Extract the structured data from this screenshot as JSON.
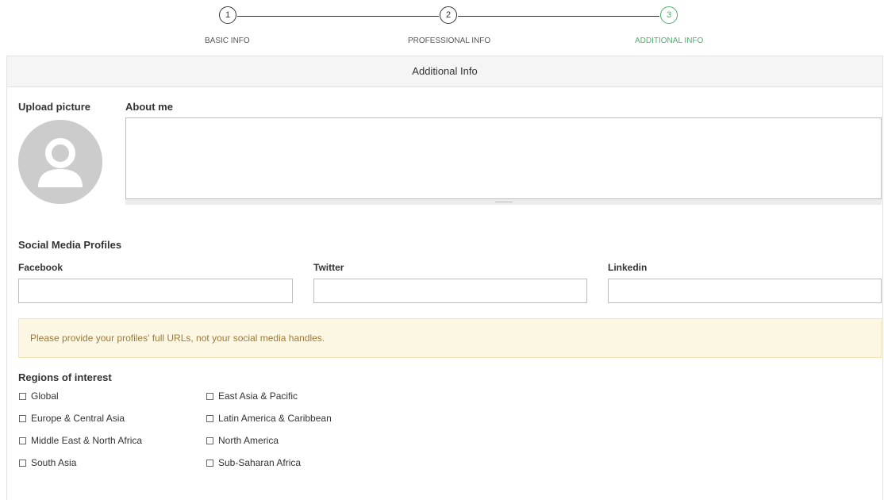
{
  "stepper": {
    "steps": [
      {
        "number": "1",
        "label": "BASIC INFO"
      },
      {
        "number": "2",
        "label": "PROFESSIONAL INFO"
      },
      {
        "number": "3",
        "label": "ADDITIONAL INFO"
      }
    ],
    "active_color": "#4caf6d"
  },
  "panel": {
    "title": "Additional Info",
    "upload_label": "Upload picture",
    "about_label": "About me",
    "about_value": "",
    "social_title": "Social Media Profiles",
    "fields": {
      "facebook_label": "Facebook",
      "twitter_label": "Twitter",
      "linkedin_label": "Linkedin",
      "facebook_value": "",
      "twitter_value": "",
      "linkedin_value": ""
    },
    "alert_text": "Please provide your profiles' full URLs, not your social media handles.",
    "regions_title": "Regions of interest",
    "regions": [
      "Global",
      "East Asia & Pacific",
      "Europe & Central Asia",
      "Latin America & Caribbean",
      "Middle East & North Africa",
      "North America",
      "South Asia",
      "Sub-Saharan Africa"
    ]
  },
  "colors": {
    "alert_bg": "#fcf7e3",
    "alert_text": "#9c7a3c",
    "avatar": "#cccccc"
  },
  "icons": {
    "avatar": "user-avatar-icon",
    "resize": "resize-handle-icon"
  }
}
